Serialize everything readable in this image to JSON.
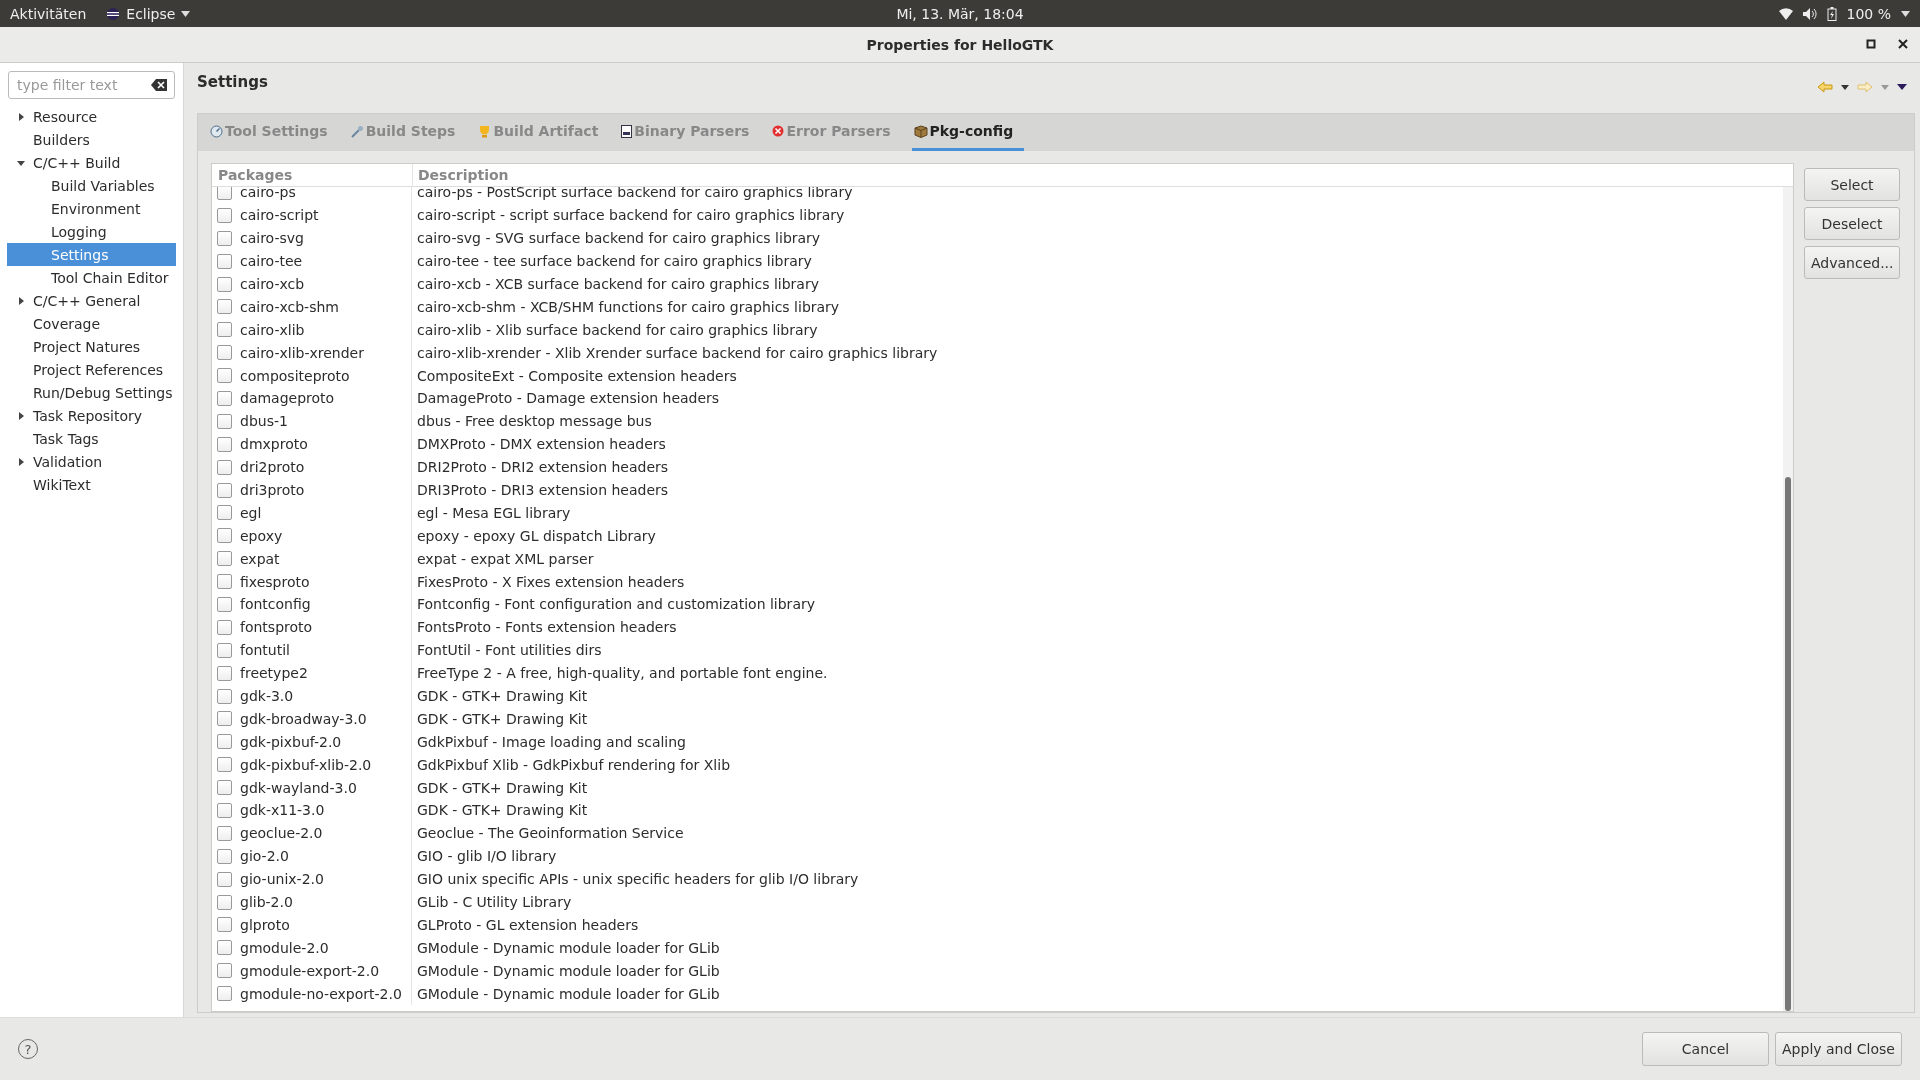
{
  "top_bar": {
    "activities": "Aktivitäten",
    "app_menu": "Eclipse",
    "clock": "Mi, 13. Mär, 18:04",
    "battery": "100 %"
  },
  "window": {
    "title": "Properties for HelloGTK"
  },
  "sidebar": {
    "filter": {
      "placeholder": "type filter text"
    },
    "items": [
      {
        "label": "Resource",
        "expanded": false,
        "selected": false
      },
      {
        "label": "Builders",
        "selected": false
      },
      {
        "label": "C/C++ Build",
        "expanded": true,
        "selected": false,
        "children": [
          {
            "label": "Build Variables",
            "selected": false
          },
          {
            "label": "Environment",
            "selected": false
          },
          {
            "label": "Logging",
            "selected": false
          },
          {
            "label": "Settings",
            "selected": true
          },
          {
            "label": "Tool Chain Editor",
            "selected": false
          }
        ]
      },
      {
        "label": "C/C++ General",
        "expanded": false,
        "selected": false
      },
      {
        "label": "Coverage",
        "selected": false
      },
      {
        "label": "Project Natures",
        "selected": false
      },
      {
        "label": "Project References",
        "selected": false
      },
      {
        "label": "Run/Debug Settings",
        "selected": false
      },
      {
        "label": "Task Repository",
        "expanded": false,
        "selected": false
      },
      {
        "label": "Task Tags",
        "selected": false
      },
      {
        "label": "Validation",
        "expanded": false,
        "selected": false
      },
      {
        "label": "WikiText",
        "selected": false
      }
    ]
  },
  "page": {
    "title": "Settings"
  },
  "tabs": [
    {
      "label": "Tool Settings",
      "kind": "tool",
      "selected": false
    },
    {
      "label": "Build Steps",
      "kind": "steps",
      "selected": false
    },
    {
      "label": "Build Artifact",
      "kind": "artifact",
      "selected": false
    },
    {
      "label": "Binary Parsers",
      "kind": "binary",
      "selected": false
    },
    {
      "label": "Error Parsers",
      "kind": "error",
      "selected": false
    },
    {
      "label": "Pkg-config",
      "kind": "package",
      "selected": true
    }
  ],
  "table": {
    "columns": [
      "Packages",
      "Description"
    ],
    "rows": [
      {
        "package": "cairo-ps",
        "description": "cairo-ps - PostScript surface backend for cairo graphics library",
        "checked": false
      },
      {
        "package": "cairo-script",
        "description": "cairo-script - script surface backend for cairo graphics library",
        "checked": false
      },
      {
        "package": "cairo-svg",
        "description": "cairo-svg - SVG surface backend for cairo graphics library",
        "checked": false
      },
      {
        "package": "cairo-tee",
        "description": "cairo-tee - tee surface backend for cairo graphics library",
        "checked": false
      },
      {
        "package": "cairo-xcb",
        "description": "cairo-xcb - XCB surface backend for cairo graphics library",
        "checked": false
      },
      {
        "package": "cairo-xcb-shm",
        "description": "cairo-xcb-shm - XCB/SHM functions for cairo graphics library",
        "checked": false
      },
      {
        "package": "cairo-xlib",
        "description": "cairo-xlib - Xlib surface backend for cairo graphics library",
        "checked": false
      },
      {
        "package": "cairo-xlib-xrender",
        "description": "cairo-xlib-xrender - Xlib Xrender surface backend for cairo graphics library",
        "checked": false
      },
      {
        "package": "compositeproto",
        "description": "CompositeExt - Composite extension headers",
        "checked": false
      },
      {
        "package": "damageproto",
        "description": "DamageProto - Damage extension headers",
        "checked": false
      },
      {
        "package": "dbus-1",
        "description": "dbus - Free desktop message bus",
        "checked": false
      },
      {
        "package": "dmxproto",
        "description": "DMXProto - DMX extension headers",
        "checked": false
      },
      {
        "package": "dri2proto",
        "description": "DRI2Proto - DRI2 extension headers",
        "checked": false
      },
      {
        "package": "dri3proto",
        "description": "DRI3Proto - DRI3 extension headers",
        "checked": false
      },
      {
        "package": "egl",
        "description": "egl - Mesa EGL library",
        "checked": false
      },
      {
        "package": "epoxy",
        "description": "epoxy - epoxy GL dispatch Library",
        "checked": false
      },
      {
        "package": "expat",
        "description": "expat - expat XML parser",
        "checked": false
      },
      {
        "package": "fixesproto",
        "description": "FixesProto - X Fixes extension headers",
        "checked": false
      },
      {
        "package": "fontconfig",
        "description": "Fontconfig - Font configuration and customization library",
        "checked": false
      },
      {
        "package": "fontsproto",
        "description": "FontsProto - Fonts extension headers",
        "checked": false
      },
      {
        "package": "fontutil",
        "description": "FontUtil - Font utilities dirs",
        "checked": false
      },
      {
        "package": "freetype2",
        "description": "FreeType 2 - A free, high-quality, and portable font engine.",
        "checked": false
      },
      {
        "package": "gdk-3.0",
        "description": "GDK - GTK+ Drawing Kit",
        "checked": false
      },
      {
        "package": "gdk-broadway-3.0",
        "description": "GDK - GTK+ Drawing Kit",
        "checked": false
      },
      {
        "package": "gdk-pixbuf-2.0",
        "description": "GdkPixbuf - Image loading and scaling",
        "checked": false
      },
      {
        "package": "gdk-pixbuf-xlib-2.0",
        "description": "GdkPixbuf Xlib - GdkPixbuf rendering for Xlib",
        "checked": false
      },
      {
        "package": "gdk-wayland-3.0",
        "description": "GDK - GTK+ Drawing Kit",
        "checked": false
      },
      {
        "package": "gdk-x11-3.0",
        "description": "GDK - GTK+ Drawing Kit",
        "checked": false
      },
      {
        "package": "geoclue-2.0",
        "description": "Geoclue - The Geoinformation Service",
        "checked": false
      },
      {
        "package": "gio-2.0",
        "description": "GIO - glib I/O library",
        "checked": false
      },
      {
        "package": "gio-unix-2.0",
        "description": "GIO unix specific APIs - unix specific headers for glib I/O library",
        "checked": false
      },
      {
        "package": "glib-2.0",
        "description": "GLib - C Utility Library",
        "checked": false
      },
      {
        "package": "glproto",
        "description": "GLProto - GL extension headers",
        "checked": false
      },
      {
        "package": "gmodule-2.0",
        "description": "GModule - Dynamic module loader for GLib",
        "checked": false
      },
      {
        "package": "gmodule-export-2.0",
        "description": "GModule - Dynamic module loader for GLib",
        "checked": false
      },
      {
        "package": "gmodule-no-export-2.0",
        "description": "GModule - Dynamic module loader for GLib",
        "checked": false
      }
    ]
  },
  "side_buttons": [
    "Select",
    "Deselect",
    "Advanced..."
  ],
  "footer": {
    "help": "?",
    "buttons": [
      "Cancel",
      "Apply and Close"
    ]
  }
}
